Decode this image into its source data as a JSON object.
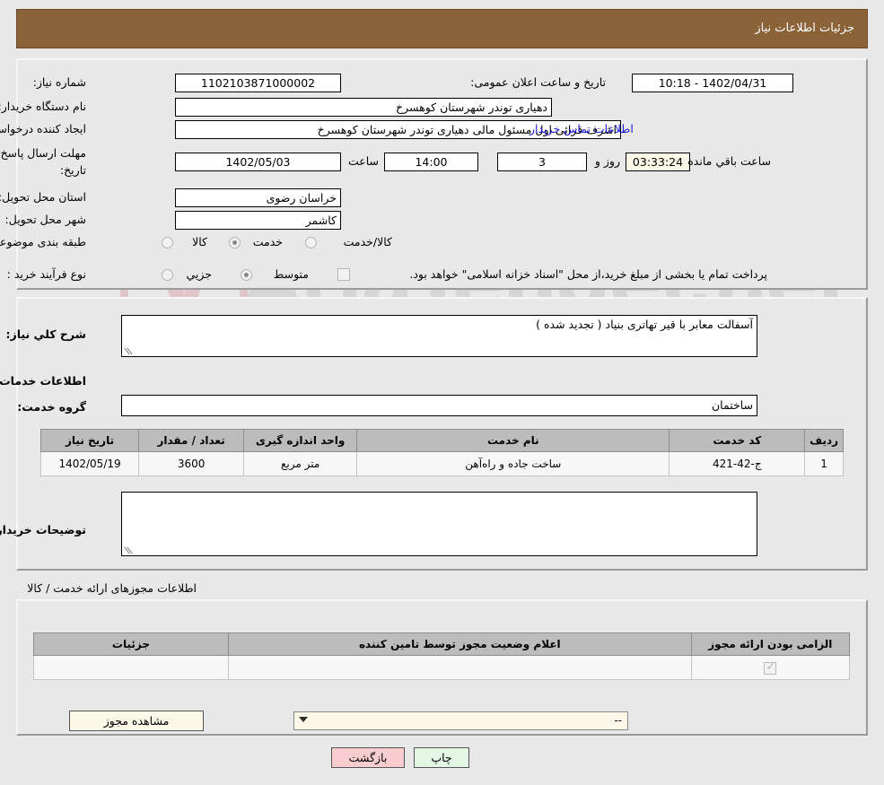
{
  "header": {
    "title": "جزئیات اطلاعات نیاز"
  },
  "watermark": {
    "text": "AriaTender.net"
  },
  "need_info": {
    "need_number_label": "شماره نیاز:",
    "need_number_value": "1102103871000002",
    "public_announce_label": "تاریخ و ساعت اعلان عمومی:",
    "public_announce_value": "1402/04/31 - 10:18",
    "buyer_org_label": "نام دستگاه خریدار:",
    "buyer_org_value": "دهیاری توندر شهرستان کوهسرخ",
    "creator_label": "ایجاد کننده درخواست:",
    "creator_value": "اشرف قرائی اول مسئول مالی دهیاری توندر شهرستان کوهسرخ",
    "contact_link": "اطلاعات تماس خریدار",
    "deadline_label": "مهلت ارسال پاسخ: تا تاریخ:",
    "deadline_date": "1402/05/03",
    "deadline_hour_label": "ساعت",
    "deadline_hour": "14:00",
    "days_value": "3",
    "days_label": "روز و",
    "countdown_value": "03:33:24",
    "countdown_label": "ساعت باقي مانده",
    "province_label": "استان محل تحویل:",
    "province_value": "خراسان رضوی",
    "city_label": "شهر محل تحویل:",
    "city_value": "کاشمر",
    "category_label": "طبقه بندی موضوعی:",
    "category_options": [
      "کالا",
      "خدمت",
      "کالا/خدمت"
    ],
    "category_selected": "خدمت",
    "process_label": "نوع فرآیند خرید :",
    "process_options": [
      "جزیي",
      "متوسط"
    ],
    "process_selected": "متوسط",
    "treasury_checkbox_checked": false,
    "treasury_note": "پرداخت تمام یا بخشی از مبلغ خرید،از محل \"اسناد خزانه اسلامی\" خواهد بود."
  },
  "description": {
    "general_label": "شرح کلي نیاز:",
    "general_value": "آسفالت معابر با قیر تهاتری بنیاد ( تجدید شده )",
    "services_section_title": "اطلاعات خدمات مورد نیاز",
    "service_group_label": "گروه خدمت:",
    "service_group_value": "ساختمان"
  },
  "services_table": {
    "columns": [
      "ردیف",
      "کد خدمت",
      "نام خدمت",
      "واحد اندازه گیری",
      "تعداد / مقدار",
      "تاریخ نیاز"
    ],
    "rows": [
      {
        "row": "1",
        "code": "ج-42-421",
        "name": "ساخت جاده و راه‌آهن",
        "unit": "متر مربع",
        "qty": "3600",
        "date": "1402/05/19"
      }
    ]
  },
  "buyer_notes": {
    "label": "توضیحات خریدار:",
    "value": ""
  },
  "permits": {
    "section_title": "اطلاعات مجوزهای ارائه خدمت / کالا",
    "columns": [
      "الزامی بودن ارائه مجوز",
      "اعلام وضعیت مجوز توسط تامین کننده",
      "جزئیات"
    ],
    "rows": [
      {
        "required_checked": true,
        "status_value": "--",
        "details_button": "مشاهده مجوز"
      }
    ]
  },
  "footer": {
    "print_button": "چاپ",
    "back_button": "بازگشت"
  },
  "colors": {
    "title_bar": "#8c6239",
    "link": "#1b1bd8",
    "print_button": "#e4f6e4",
    "back_button": "#f9ccd0",
    "cream_field": "#fbf8e8",
    "table_header": "#bcbcbc"
  }
}
